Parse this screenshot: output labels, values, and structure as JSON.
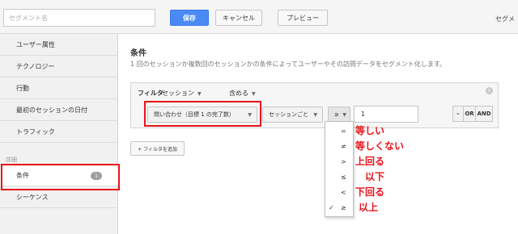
{
  "toolbar": {
    "segment_name_placeholder": "セグメント名",
    "save_label": "保存",
    "cancel_label": "キャンセル",
    "preview_label": "プレビュー",
    "right_label": "セグメ"
  },
  "sidebar": {
    "items": [
      {
        "label": "ユーザー属性"
      },
      {
        "label": "テクノロジー"
      },
      {
        "label": "行動"
      },
      {
        "label": "最初のセッションの日付"
      },
      {
        "label": "トラフィック"
      }
    ],
    "section_label": "詳細",
    "advanced_items": [
      {
        "label": "条件",
        "badge": "1"
      },
      {
        "label": "シーケンス"
      }
    ]
  },
  "main": {
    "title": "条件",
    "description": "1 回のセッションか複数回のセッションかの条件によってユーザーやその訪問データをセグメント化します。",
    "filter": {
      "label": "フィルタ",
      "scope": "セッション",
      "mode": "含める",
      "close": "×",
      "metric": "問い合わせ（目標 1 の完了数）",
      "per": "セッションごと",
      "operator": "≥",
      "value": "1",
      "minus": "–",
      "or": "OR",
      "and": "AND"
    },
    "add_filter": "+ フィルタを追加"
  },
  "operator_menu": {
    "items": [
      {
        "symbol": "=",
        "note": "等しい"
      },
      {
        "symbol": "≠",
        "note": "等しくない"
      },
      {
        "symbol": ">",
        "note": "上回る"
      },
      {
        "symbol": "≤",
        "note": "以下"
      },
      {
        "symbol": "<",
        "note": "下回る"
      },
      {
        "symbol": "≥",
        "note": "以上",
        "checked": "✓"
      }
    ]
  },
  "colors": {
    "primary_button": "#4a8af4",
    "highlight": "#e8121a",
    "annotation": "#e8121a"
  }
}
